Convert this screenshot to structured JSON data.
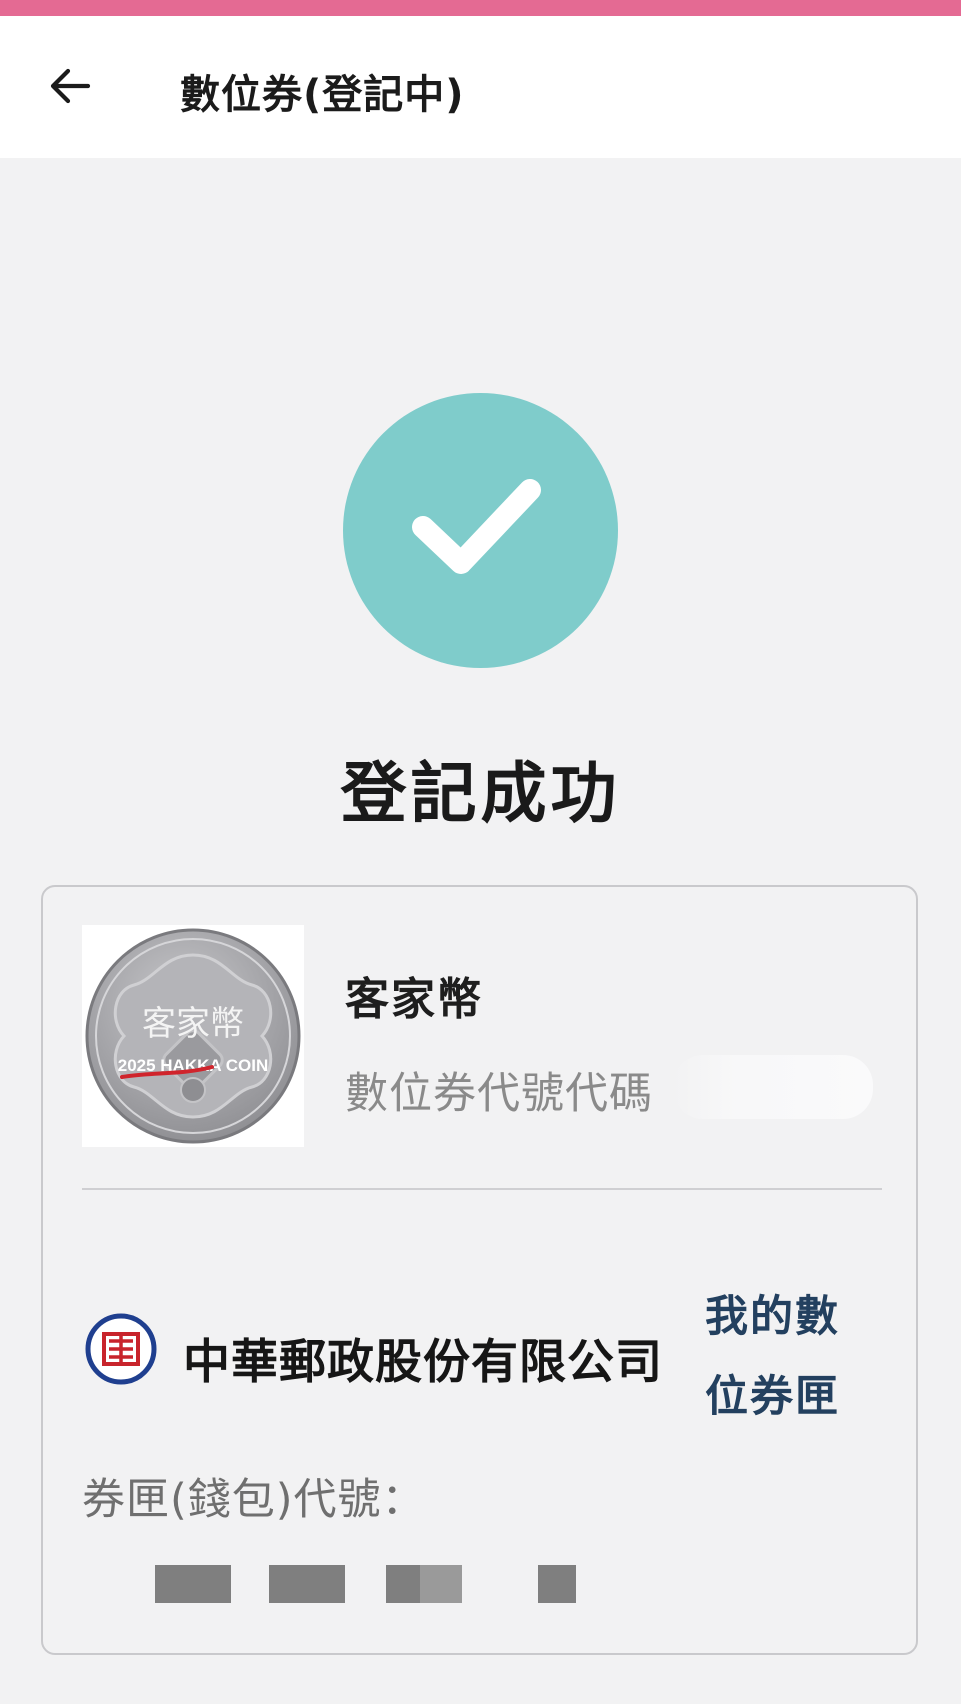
{
  "header": {
    "title": "數位券(登記中)",
    "back_icon": "back-arrow-icon"
  },
  "status": {
    "title": "登記成功",
    "icon": "check-circle-icon",
    "circle_color": "#7fcccb"
  },
  "voucher": {
    "name": "客家幣",
    "code_label": "數位券代號",
    "code_value_partial": "代碼",
    "image": {
      "name": "hakka-coin-image",
      "text_top": "客家幣",
      "text_bottom": "2025 HAKKA COIN"
    }
  },
  "provider": {
    "name": "中華郵政股份有限公司",
    "logo_icon": "chunghwa-post-logo-icon",
    "logo_glyph": "郵",
    "wallet_link": "我的數位券匣"
  },
  "wallet": {
    "id_label": "券匣(錢包)代號："
  },
  "colors": {
    "accent_pink": "#e46a93",
    "success_teal": "#7fcccb",
    "link_navy": "#23405f",
    "post_red": "#c8242c",
    "post_blue": "#1f3f8f"
  }
}
